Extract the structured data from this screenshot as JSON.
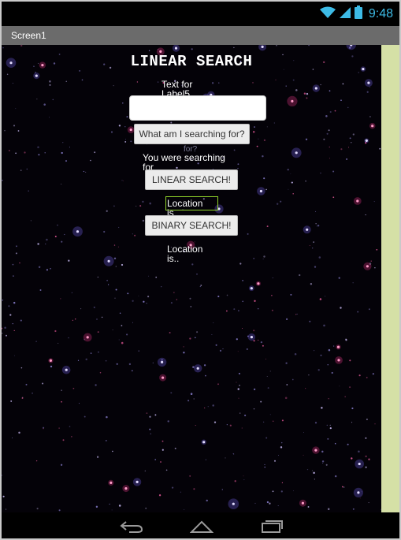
{
  "status_bar": {
    "time": "9:48"
  },
  "app_bar": {
    "title": "Screen1"
  },
  "main": {
    "title": "LINEAR SEARCH",
    "label5": "Text for Label5",
    "search_input": {
      "value": "",
      "placeholder": ""
    },
    "what_button": "What am I searching for?",
    "searching_label": "You were searching for",
    "linear_button": "LINEAR SEARCH!",
    "location_label_1": "Location is",
    "binary_button": "BINARY SEARCH!",
    "location_label_2": "Location is.."
  },
  "colors": {
    "background": "#040208",
    "side_strip": "#d5e0a6",
    "title_bar": "#6b6b6b",
    "status_time": "#3dbbe6",
    "highlight": "#8fd12a"
  },
  "icons": {
    "status": [
      "wifi-icon",
      "signal-icon",
      "battery-icon"
    ],
    "nav": [
      "back-icon",
      "home-icon",
      "recents-icon"
    ]
  }
}
